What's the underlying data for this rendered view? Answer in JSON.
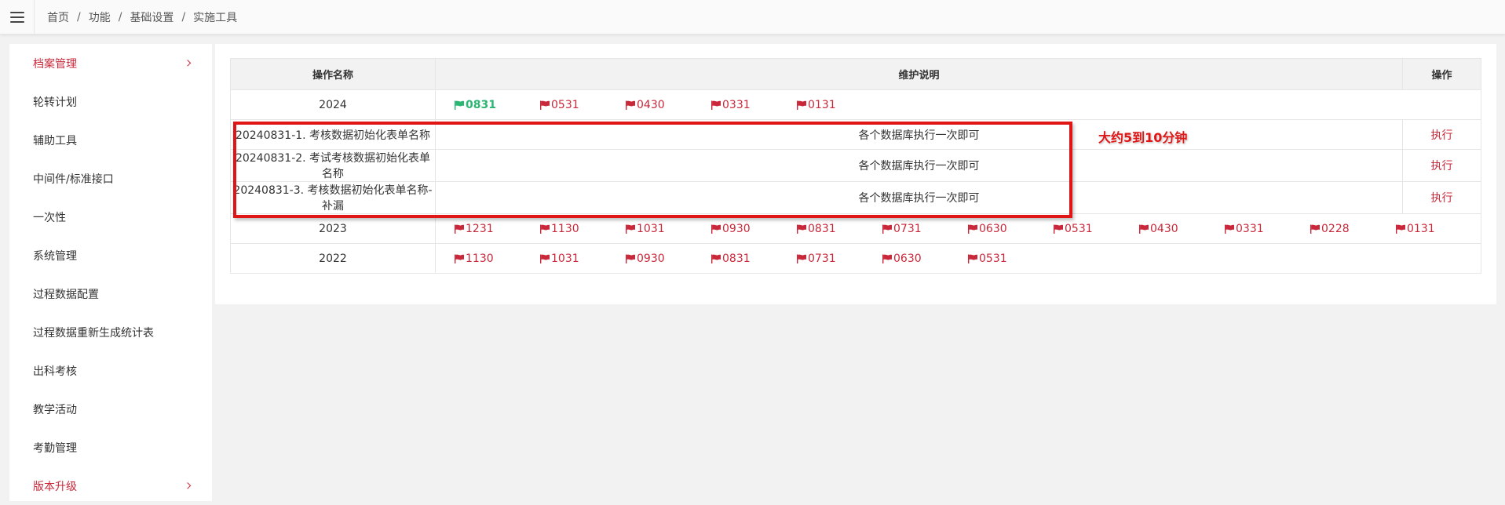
{
  "breadcrumb": [
    "首页",
    "功能",
    "基础设置",
    "实施工具"
  ],
  "sidebar": {
    "items": [
      {
        "label": "档案管理",
        "active": true,
        "expandable": true
      },
      {
        "label": "轮转计划"
      },
      {
        "label": "辅助工具"
      },
      {
        "label": "中间件/标准接口"
      },
      {
        "label": "一次性"
      },
      {
        "label": "系统管理"
      },
      {
        "label": "过程数据配置"
      },
      {
        "label": "过程数据重新生成统计表"
      },
      {
        "label": "出科考核"
      },
      {
        "label": "教学活动"
      },
      {
        "label": "考勤管理"
      },
      {
        "label": "版本升级",
        "active": true,
        "expandable": true
      }
    ]
  },
  "table": {
    "headers": {
      "name": "操作名称",
      "desc": "维护说明",
      "op": "操作"
    },
    "year_2024": {
      "label": "2024",
      "flags": [
        "0831",
        "0531",
        "0430",
        "0331",
        "0131"
      ]
    },
    "tasks": [
      {
        "name": "20240831-1. 考核数据初始化表单名称",
        "desc": "各个数据库执行一次即可",
        "action": "执行"
      },
      {
        "name": "20240831-2. 考试考核数据初始化表单名称",
        "desc": "各个数据库执行一次即可",
        "action": "执行"
      },
      {
        "name": "20240831-3. 考核数据初始化表单名称-补漏",
        "desc": "各个数据库执行一次即可",
        "action": "执行"
      }
    ],
    "year_2023": {
      "label": "2023",
      "flags": [
        "1231",
        "1130",
        "1031",
        "0930",
        "0831",
        "0731",
        "0630",
        "0531",
        "0430",
        "0331",
        "0228",
        "0131"
      ]
    },
    "year_2022": {
      "label": "2022",
      "flags": [
        "1130",
        "1031",
        "0930",
        "0831",
        "0731",
        "0630",
        "0531"
      ]
    }
  },
  "annotation": {
    "note": "大约5到10分钟"
  },
  "colors": {
    "accent": "#c9283a",
    "active_flag": "#2bb673",
    "highlight": "#e01515"
  }
}
